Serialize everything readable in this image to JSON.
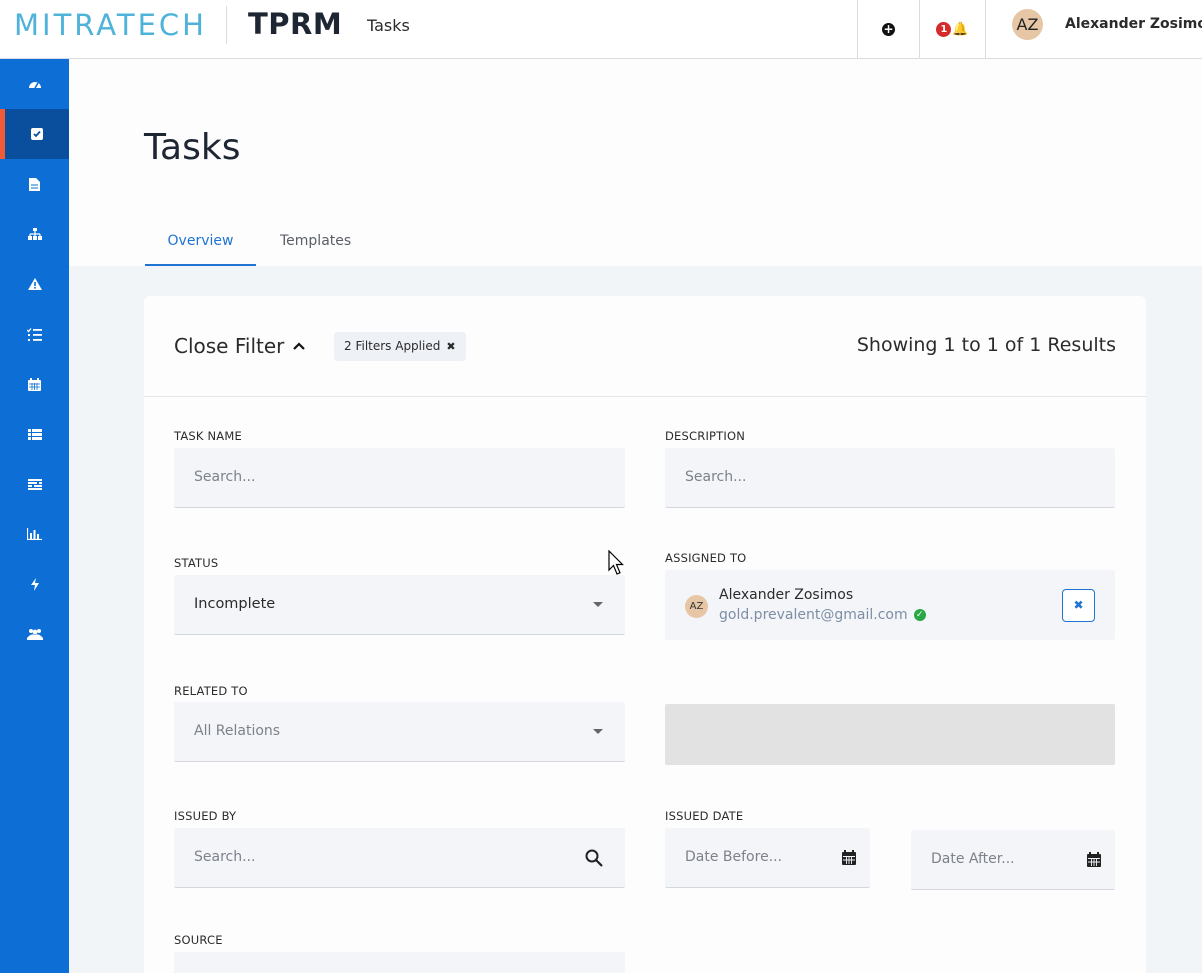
{
  "brand": {
    "logo": "MITRATECH",
    "product": "TPRM"
  },
  "topbar": {
    "page": "Tasks",
    "notification_count": "1",
    "user_initials": "AZ",
    "user_name": "Alexander Zosimos"
  },
  "sidebar": {
    "items": [
      {
        "icon": "dashboard-icon"
      },
      {
        "icon": "tasks-check-icon",
        "active": true
      },
      {
        "icon": "document-icon"
      },
      {
        "icon": "org-chart-icon"
      },
      {
        "icon": "warning-icon"
      },
      {
        "icon": "checklist-icon"
      },
      {
        "icon": "calendar-icon"
      },
      {
        "icon": "list-icon"
      },
      {
        "icon": "stacked-list-icon"
      },
      {
        "icon": "bar-chart-icon"
      },
      {
        "icon": "lightning-icon"
      },
      {
        "icon": "users-icon"
      }
    ]
  },
  "main": {
    "title": "Tasks",
    "tabs": [
      {
        "label": "Overview",
        "active": true
      },
      {
        "label": "Templates"
      }
    ]
  },
  "filter": {
    "toggle_label": "Close Filter",
    "chip_label": "2 Filters Applied",
    "results_text": "Showing 1 to 1 of 1 Results",
    "task_name": {
      "label": "TASK NAME",
      "placeholder": "Search..."
    },
    "description": {
      "label": "DESCRIPTION",
      "placeholder": "Search..."
    },
    "status": {
      "label": "STATUS",
      "value": "Incomplete"
    },
    "assigned_to": {
      "label": "ASSIGNED TO",
      "initials": "AZ",
      "name": "Alexander Zosimos",
      "email": "gold.prevalent@gmail.com"
    },
    "related_to": {
      "label": "RELATED TO",
      "value": "All Relations"
    },
    "issued_by": {
      "label": "ISSUED BY",
      "placeholder": "Search..."
    },
    "issued_date": {
      "label": "ISSUED DATE",
      "before_placeholder": "Date Before...",
      "after_placeholder": "Date After..."
    },
    "source": {
      "label": "SOURCE"
    }
  },
  "colors": {
    "sidebar": "#0d6fd6",
    "sidebar_active": "#0a4f9e",
    "active_marker": "#ef5a37",
    "accent": "#1f73d2",
    "logo": "#4fb3d9"
  }
}
